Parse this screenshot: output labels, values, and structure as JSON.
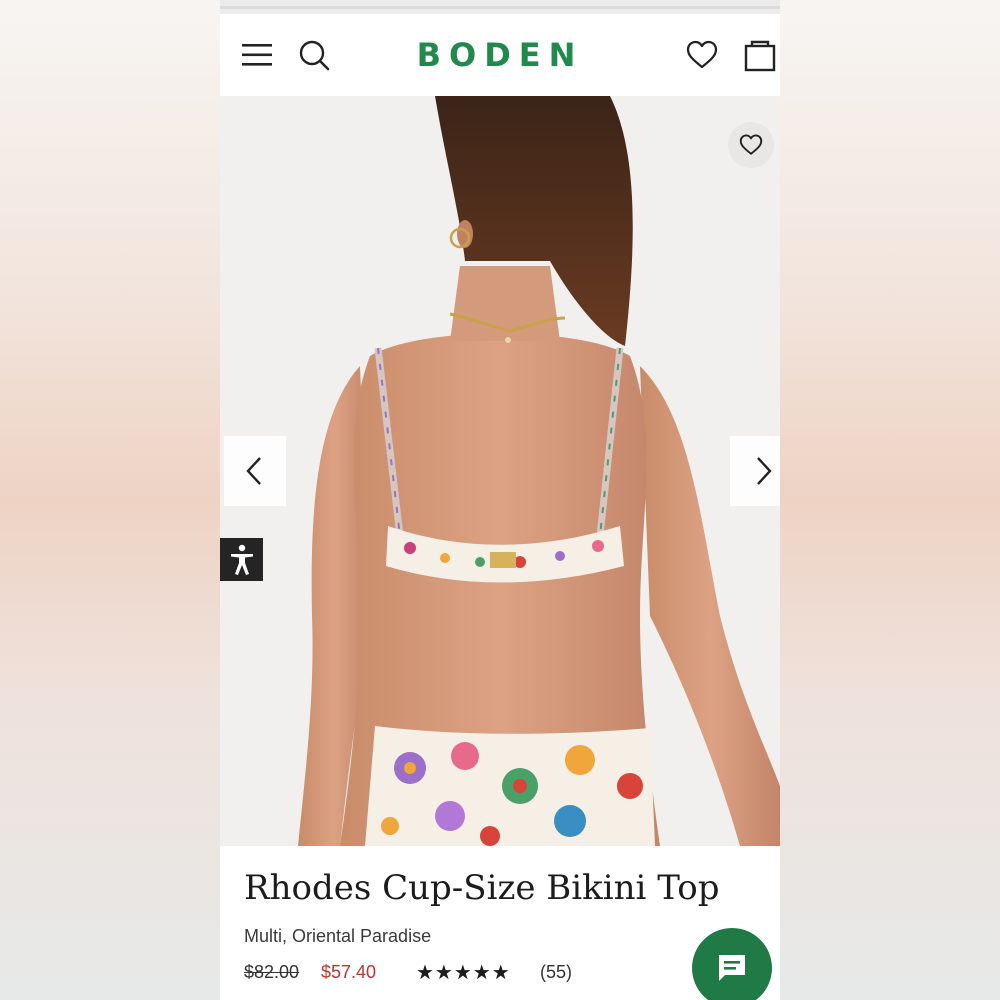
{
  "header": {
    "brand": "BODEN",
    "menu_icon": "hamburger-menu-icon",
    "search_icon": "search-icon",
    "wishlist_icon": "heart-icon",
    "bag_icon": "shopping-bag-icon"
  },
  "gallery": {
    "favorite_icon": "heart-icon",
    "prev_icon": "chevron-left-icon",
    "next_icon": "chevron-right-icon",
    "accessibility_icon": "accessibility-icon"
  },
  "product": {
    "name": "Rhodes Cup-Size Bikini Top",
    "color": "Multi, Oriental Paradise",
    "price_original": "$82.00",
    "price_sale": "$57.40",
    "rating": 4.5,
    "rating_stars": "★★★★★",
    "review_count": "(55)"
  },
  "chat": {
    "icon": "chat-bubble-icon"
  },
  "colors": {
    "brand_green": "#1f8a4c",
    "sale_red": "#b8352f",
    "chat_green": "#1f7a45"
  }
}
